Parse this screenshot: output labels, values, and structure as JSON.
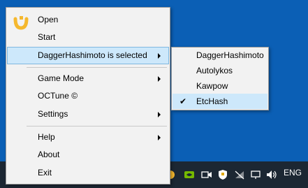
{
  "context_menu": {
    "items": [
      {
        "label": "Open",
        "has_submenu": false
      },
      {
        "label": "Start",
        "has_submenu": false
      },
      {
        "label": "DaggerHashimoto is selected",
        "has_submenu": true,
        "highlighted": true
      },
      {
        "label": "Game Mode",
        "has_submenu": true
      },
      {
        "label": "OCTune ©",
        "has_submenu": false
      },
      {
        "label": "Settings",
        "has_submenu": true
      },
      {
        "label": "Help",
        "has_submenu": true
      },
      {
        "label": "About",
        "has_submenu": false
      },
      {
        "label": "Exit",
        "has_submenu": false
      }
    ]
  },
  "algorithm_submenu": {
    "items": [
      {
        "label": "DaggerHashimoto",
        "checked": false
      },
      {
        "label": "Autolykos",
        "checked": false
      },
      {
        "label": "Kawpow",
        "checked": false
      },
      {
        "label": "EtcHash",
        "checked": true
      }
    ],
    "check_glyph": "✔"
  },
  "taskbar": {
    "language": "ENG",
    "tray_icons": [
      "nicehash-tray-icon",
      "nvidia-icon",
      "meet-now-icon",
      "security-shield-icon",
      "network-disconnected-icon",
      "display-icon",
      "volume-icon"
    ]
  },
  "colors": {
    "desktop": "#0b5fb5",
    "taskbar": "#1c2733",
    "menu_bg": "#f2f2f2",
    "highlight": "#cde8fb",
    "logo": "#f5b82e"
  }
}
